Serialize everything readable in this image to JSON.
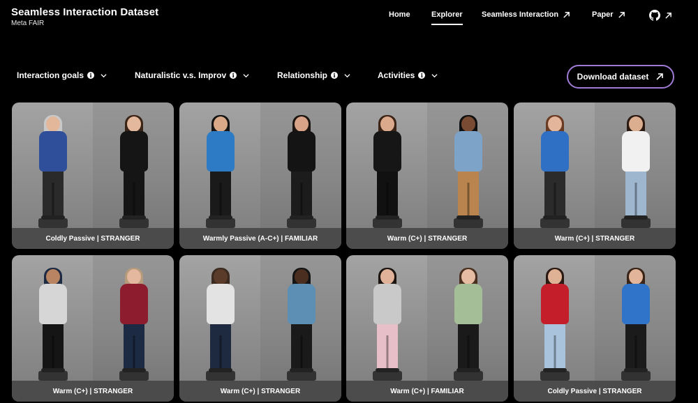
{
  "header": {
    "title": "Seamless Interaction Dataset",
    "subtitle": "Meta FAIR",
    "nav": [
      {
        "label": "Home",
        "active": false,
        "external": false
      },
      {
        "label": "Explorer",
        "active": true,
        "external": false
      },
      {
        "label": "Seamless Interaction",
        "active": false,
        "external": true
      },
      {
        "label": "Paper",
        "active": false,
        "external": true
      }
    ],
    "github_icon": "github-icon"
  },
  "filters": [
    {
      "label": "Interaction goals"
    },
    {
      "label": "Naturalistic v.s. Improv"
    },
    {
      "label": "Relationship"
    },
    {
      "label": "Activities"
    }
  ],
  "download": {
    "label": "Download dataset",
    "border_color": "#a07bd6"
  },
  "cards": [
    {
      "caption": "Coldly Passive | STRANGER",
      "left": {
        "top": "#2f4f9a",
        "legs": "#2a2a2a",
        "hair": "#c9c9c9",
        "skin": "#e2b79a"
      },
      "right": {
        "top": "#151515",
        "legs": "#151515",
        "hair": "#3a2418",
        "skin": "#e4b89c"
      }
    },
    {
      "caption": "Warmly Passive (A-C+) | FAMILIAR",
      "left": {
        "top": "#2d7bc4",
        "legs": "#1a1a1a",
        "hair": "#141414",
        "skin": "#d9a988"
      },
      "right": {
        "top": "#141414",
        "legs": "#1c1c1c",
        "hair": "#1b1410",
        "skin": "#d8a386"
      }
    },
    {
      "caption": "Warm (C+) | STRANGER",
      "left": {
        "top": "#161616",
        "legs": "#111111",
        "hair": "#3b2315",
        "skin": "#dbaa8d"
      },
      "right": {
        "top": "#7ea3c9",
        "legs": "#b9844e",
        "hair": "#101010",
        "skin": "#7a4b33"
      }
    },
    {
      "caption": "Warm (C+) | STRANGER",
      "left": {
        "top": "#2f6fc4",
        "legs": "#2b2b2b",
        "hair": "#6a3b22",
        "skin": "#e3b69b"
      },
      "right": {
        "top": "#f1f1f1",
        "legs": "#9fb6cf",
        "hair": "#2b1a12",
        "skin": "#dcae90"
      }
    },
    {
      "caption": "Warm (C+) | STRANGER",
      "left": {
        "top": "#d6d6d6",
        "legs": "#151515",
        "hair": "#1d2a44",
        "skin": "#b98461"
      },
      "right": {
        "top": "#8c1c2e",
        "legs": "#1d2a44",
        "hair": "#b59a7c",
        "skin": "#e3b89e"
      }
    },
    {
      "caption": "Warm (C+) | STRANGER",
      "left": {
        "top": "#e3e3e3",
        "legs": "#1e2a40",
        "hair": "#3a2a20",
        "skin": "#5a3a28"
      },
      "right": {
        "top": "#5c8fb3",
        "legs": "#1a1a1a",
        "hair": "#141414",
        "skin": "#4a2e20"
      }
    },
    {
      "caption": "Warm (C+) | FAMILIAR",
      "left": {
        "top": "#c9c9c9",
        "legs": "#e7bfc8",
        "hair": "#1b1410",
        "skin": "#e0b299"
      },
      "right": {
        "top": "#a4bf97",
        "legs": "#1a1a1a",
        "hair": "#4a3020",
        "skin": "#e6bda3"
      }
    },
    {
      "caption": "Coldly Passive | STRANGER",
      "left": {
        "top": "#c31e2a",
        "legs": "#a9c3dc",
        "hair": "#2a1a12",
        "skin": "#dfb195"
      },
      "right": {
        "top": "#2f74c8",
        "legs": "#1b1b1b",
        "hair": "#3a2418",
        "skin": "#e2b59a"
      }
    }
  ]
}
